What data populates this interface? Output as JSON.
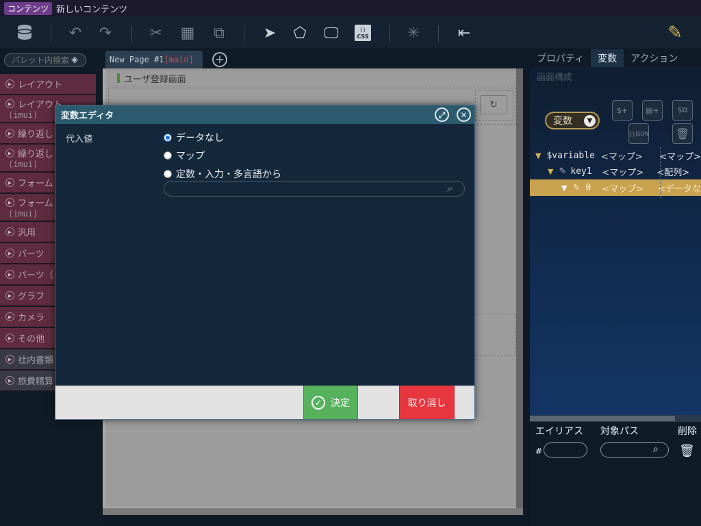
{
  "titlebar": {
    "badge": "コンテンツ",
    "title": "新しいコンテンツ"
  },
  "toolbar": {
    "icons": [
      "database-icon",
      "undo-icon",
      "redo-icon",
      "cut-icon",
      "copy-icon",
      "paste-icon",
      "pointer-icon",
      "select-area-icon",
      "preview-icon",
      "css-icon",
      "loading-icon",
      "panel-icon",
      "edit-icon"
    ]
  },
  "palette": {
    "search_placeholder": "パレット内検索",
    "items": [
      {
        "label": "レイアウト",
        "sub": ""
      },
      {
        "label": "レイアウト",
        "sub": "(imui)"
      },
      {
        "label": "繰り返し",
        "sub": ""
      },
      {
        "label": "繰り返し",
        "sub": "(imui)"
      },
      {
        "label": "フォーム",
        "sub": ""
      },
      {
        "label": "フォーム",
        "sub": "(imui)"
      },
      {
        "label": "汎用",
        "sub": ""
      },
      {
        "label": "パーツ",
        "sub": ""
      },
      {
        "label": "パーツ（",
        "sub": ""
      },
      {
        "label": "グラフ",
        "sub": ""
      },
      {
        "label": "カメラ",
        "sub": ""
      },
      {
        "label": "その他",
        "sub": ""
      },
      {
        "label": "社内書類",
        "sub": ""
      },
      {
        "label": "旅費精算",
        "sub": ""
      }
    ]
  },
  "page_tab": {
    "name": "New Page #1",
    "tag": "[main]"
  },
  "canvas": {
    "screen_name": "ユーザ登録画面"
  },
  "right_panel": {
    "tabs": [
      "プロパティ",
      "変数",
      "アクション"
    ],
    "active_tab": "変数",
    "screen_struct": "画面構成",
    "var_dropdown": "変数",
    "tree": [
      {
        "name": "$variable",
        "type": "<マップ>",
        "extra": "<マップ>"
      },
      {
        "name": "key1",
        "type": "<マップ>",
        "extra": "<配列>"
      },
      {
        "name": "0",
        "type": "<マップ>",
        "extra": "<データな"
      }
    ],
    "alias_headers": {
      "alias": "エイリアス",
      "path": "対象パス",
      "delete": "削除"
    },
    "alias_hash": "#"
  },
  "modal": {
    "title": "変数エディタ",
    "assign_label": "代入値",
    "options": [
      "データなし",
      "マップ",
      "定数・入力・多言語から"
    ],
    "selected_option": 0,
    "ok_label": "決定",
    "cancel_label": "取り消し"
  }
}
